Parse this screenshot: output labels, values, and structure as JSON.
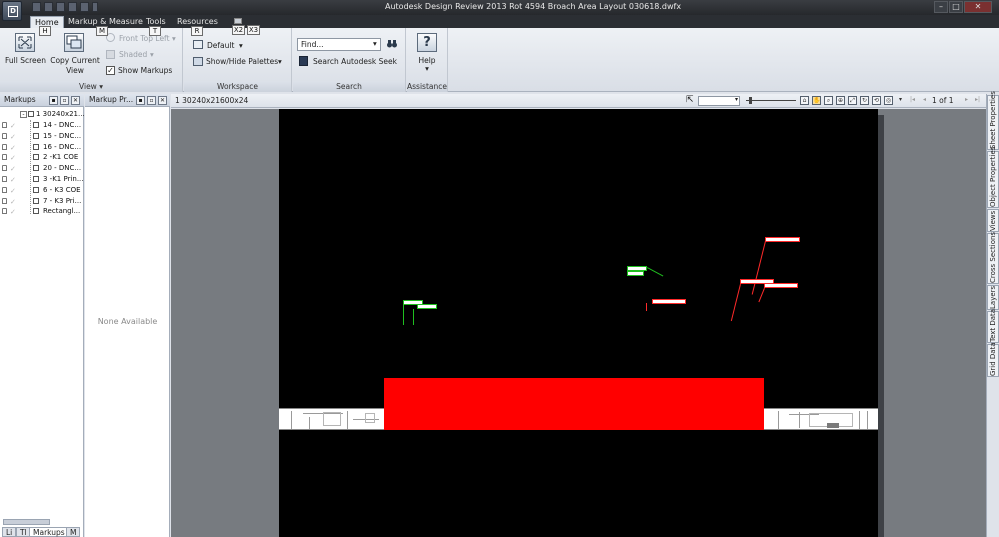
{
  "window": {
    "title": "Autodesk Design Review 2013     Rot  4594 Broach Area Layout  030618.dwfx",
    "app_button_glyph": "D",
    "controls": [
      "–",
      "□",
      "✕"
    ]
  },
  "quick_access": [
    "open-icon",
    "save-icon",
    "print-icon",
    "undo-icon",
    "redo-icon",
    "qat-menu-icon"
  ],
  "tabs": [
    {
      "label": "Home",
      "keytip": "H",
      "active": true
    },
    {
      "label": "Markup & Measure",
      "keytip": "M"
    },
    {
      "label": "Tools",
      "keytip": "T"
    },
    {
      "label": "Resources",
      "keytip": "R"
    }
  ],
  "keytips_extra": [
    "X2",
    "X3"
  ],
  "ribbon": {
    "view": {
      "full_screen": "Full Screen",
      "copy_current_view": "Copy Current View",
      "front_top_left": "Front Top Left",
      "shaded": "Shaded",
      "show_markups": "Show Markups",
      "title": "View"
    },
    "workspace": {
      "default": "Default",
      "show_hide_palettes": "Show/Hide Palettes",
      "title": "Workspace"
    },
    "search": {
      "find_value": "Find...",
      "search_seek": "Search Autodesk Seek",
      "title": "Search"
    },
    "assistance": {
      "help": "Help",
      "title": "Assistance"
    }
  },
  "markups_panel": {
    "title": "Markups",
    "root": "1 30240x21...",
    "items": [
      "14 - DNC...",
      "15 - DNC...",
      "16 - DNC...",
      "2 -K1 COE",
      "20 - DNC...",
      "3 -K1 Prin...",
      "6 - K3 COE",
      "7 - K3 Pri...",
      "Rectangl..."
    ]
  },
  "properties_panel": {
    "title": "Markup Pr...",
    "empty_text": "None Available"
  },
  "bottom_tabs": [
    "Li",
    "Tl",
    "Markups",
    "M"
  ],
  "canvas": {
    "sheet_label": "1 30240x21600x24",
    "page_count": "1 of 1",
    "colors": {
      "sheet": "#000000",
      "markup_fill": "#ff0000",
      "canvas_bg": "#777b80"
    }
  },
  "right_tabs": [
    "Sheet Properties",
    "Object Properties",
    "Views",
    "Cross Sections",
    "Layers",
    "Text Data",
    "Grid Data"
  ]
}
